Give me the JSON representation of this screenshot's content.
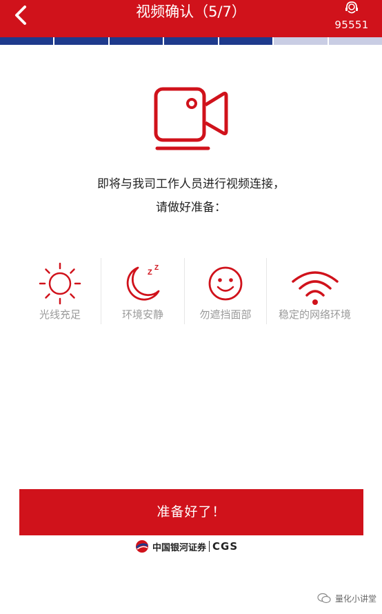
{
  "header": {
    "title": "视频确认（5/7）",
    "hotline": "95551",
    "background": "#d0121b"
  },
  "progress": {
    "total_steps": 7,
    "completed_steps": 5,
    "done_color": "#1e3a8c",
    "todo_color": "#c9cde4"
  },
  "main": {
    "icon": "video-camera-icon",
    "line1": "即将与我司工作人员进行视频连接，",
    "line2": "请做好准备："
  },
  "tips": [
    {
      "icon": "sun-icon",
      "label": "光线充足"
    },
    {
      "icon": "moon-icon",
      "label": "环境安静"
    },
    {
      "icon": "smile-icon",
      "label": "勿遮挡面部"
    },
    {
      "icon": "wifi-icon",
      "label": "稳定的网络环境"
    }
  ],
  "ready_button": "准备好了！",
  "brand": {
    "name": "中国银河证券",
    "abbr": "CGS"
  },
  "watermark": "量化小讲堂",
  "colors": {
    "accent": "#d0121b",
    "text_muted": "#9a9a9a"
  }
}
